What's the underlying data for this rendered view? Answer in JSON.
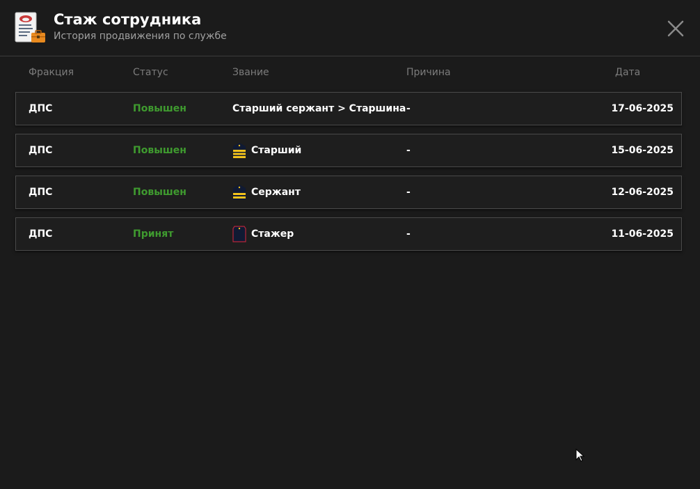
{
  "header": {
    "title": "Стаж сотрудника",
    "subtitle": "История продвижения по службе",
    "icon": "document-briefcase-icon",
    "close_icon": "close-icon"
  },
  "columns": {
    "faction": "Фракция",
    "status": "Статус",
    "rank": "Звание",
    "reason": "Причина",
    "date": "Дата"
  },
  "colors": {
    "background": "#1b1b1b",
    "status_green": "#3f9b2f",
    "header_text": "#7c7c7c",
    "row_border": "#4a4a4a",
    "stripe_yellow": "#f2c21b",
    "shoulder_navy": "#101a33",
    "trainee_red": "#b8263a"
  },
  "rows": [
    {
      "faction": "ДПС",
      "status": "Повышен",
      "rank": "Старший сержант > Старшина",
      "rank_icon": "",
      "reason": "-",
      "date": "17-06-2025"
    },
    {
      "faction": "ДПС",
      "status": "Повышен",
      "rank": "Старший",
      "rank_icon": "shoulder-board-stripes-icon",
      "reason": "-",
      "date": "15-06-2025"
    },
    {
      "faction": "ДПС",
      "status": "Повышен",
      "rank": "Сержант",
      "rank_icon": "shoulder-board-stripes-icon",
      "reason": "-",
      "date": "12-06-2025"
    },
    {
      "faction": "ДПС",
      "status": "Принят",
      "rank": "Стажер",
      "rank_icon": "shoulder-board-trainee-icon",
      "reason": "-",
      "date": "11-06-2025"
    }
  ]
}
